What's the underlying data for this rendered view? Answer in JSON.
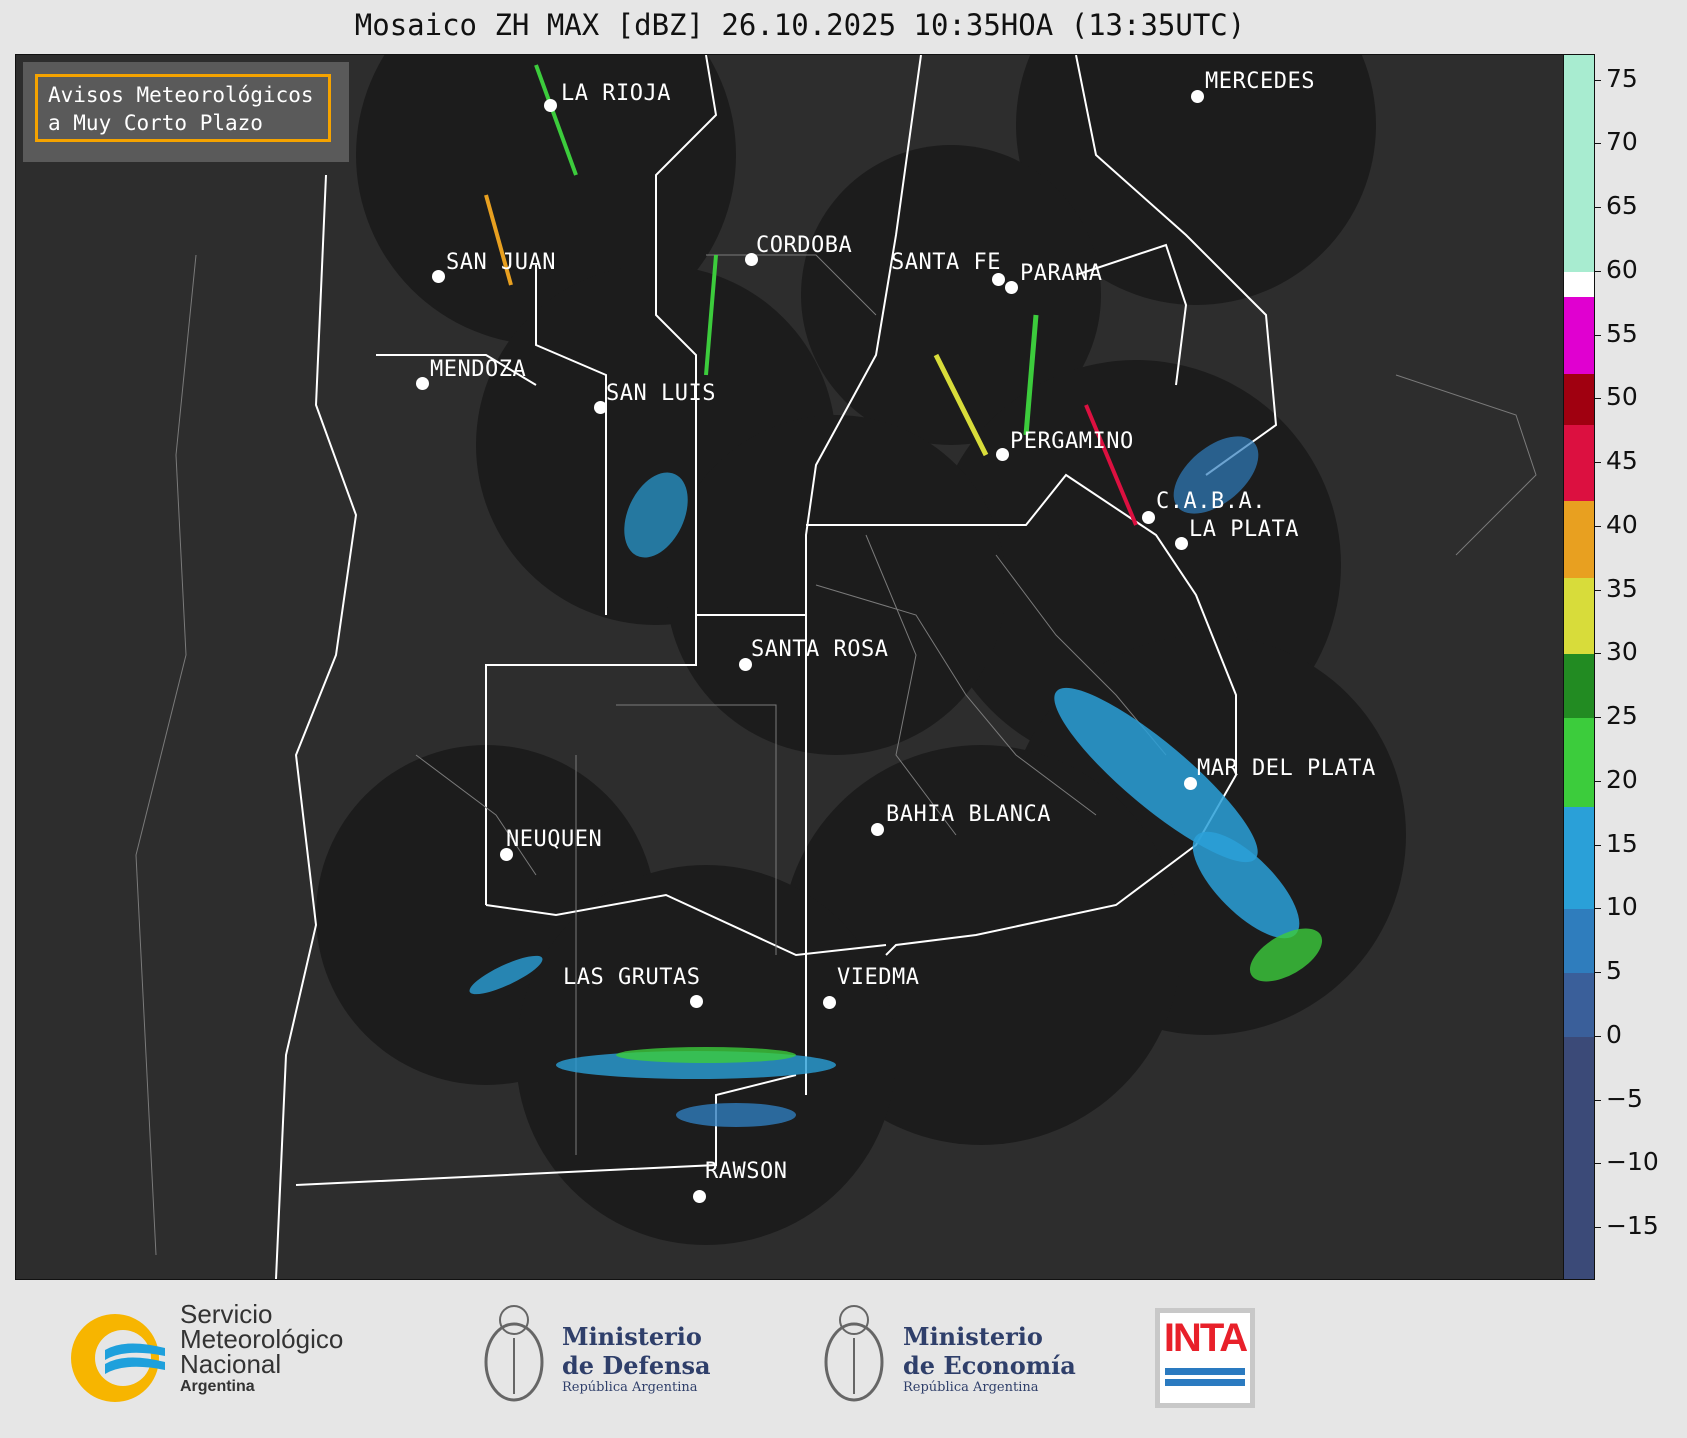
{
  "title": "Mosaico ZH MAX [dBZ] 26.10.2025 10:35HOA (13:35UTC)",
  "warning_box": {
    "line1": "Avisos Meteorológicos",
    "line2": "a Muy Corto Plazo"
  },
  "cities": [
    {
      "name": "LA RIOJA"
    },
    {
      "name": "CORDOBA"
    },
    {
      "name": "SAN JUAN"
    },
    {
      "name": "SANTA FE"
    },
    {
      "name": "PARANA"
    },
    {
      "name": "MENDOZA"
    },
    {
      "name": "SAN LUIS"
    },
    {
      "name": "PERGAMINO"
    },
    {
      "name": "C.A.B.A."
    },
    {
      "name": "LA PLATA"
    },
    {
      "name": "MERCEDES"
    },
    {
      "name": "SANTA ROSA"
    },
    {
      "name": "MAR DEL PLATA"
    },
    {
      "name": "BAHIA BLANCA"
    },
    {
      "name": "NEUQUEN"
    },
    {
      "name": "LAS GRUTAS"
    },
    {
      "name": "VIEDMA"
    },
    {
      "name": "RAWSON"
    }
  ],
  "colorbar": {
    "unit": "dBZ",
    "min": -19,
    "max": 77,
    "ticks": [
      75,
      70,
      65,
      60,
      55,
      50,
      45,
      40,
      35,
      30,
      25,
      20,
      15,
      10,
      5,
      0,
      -5,
      -10,
      -15
    ],
    "tick_labels": [
      "75",
      "70",
      "65",
      "60",
      "55",
      "50",
      "45",
      "40",
      "35",
      "30",
      "25",
      "20",
      "15",
      "10",
      "5",
      "0",
      "−5",
      "−10",
      "−15"
    ],
    "bands": [
      {
        "from": -19,
        "to": 0,
        "color": "#3b4a78"
      },
      {
        "from": 0,
        "to": 5,
        "color": "#3a5f9a"
      },
      {
        "from": 5,
        "to": 10,
        "color": "#2f7dbd"
      },
      {
        "from": 10,
        "to": 18,
        "color": "#2aa0d8"
      },
      {
        "from": 18,
        "to": 25,
        "color": "#3ccc3c"
      },
      {
        "from": 25,
        "to": 30,
        "color": "#228b22"
      },
      {
        "from": 30,
        "to": 36,
        "color": "#d8dc3a"
      },
      {
        "from": 36,
        "to": 42,
        "color": "#e8a020"
      },
      {
        "from": 42,
        "to": 48,
        "color": "#dc1040"
      },
      {
        "from": 48,
        "to": 52,
        "color": "#a00010"
      },
      {
        "from": 52,
        "to": 58,
        "color": "#e000d0"
      },
      {
        "from": 58,
        "to": 60,
        "color": "#ffffff"
      },
      {
        "from": 60,
        "to": 77,
        "color": "#a8ecd0"
      }
    ]
  },
  "logos": {
    "smn": {
      "line1": "Servicio",
      "line2": "Meteorológico",
      "line3": "Nacional",
      "line4": "Argentina"
    },
    "defensa": {
      "line1": "Ministerio",
      "line2": "de Defensa",
      "line3": "República Argentina"
    },
    "economia": {
      "line1": "Ministerio",
      "line2": "de Economía",
      "line3": "República Argentina"
    },
    "inta": {
      "text": "INTA"
    }
  },
  "colors": {
    "map_bg": "#2d2d2d",
    "radar_coverage": "#1c1c1c",
    "warning_border": "#f5a300"
  }
}
